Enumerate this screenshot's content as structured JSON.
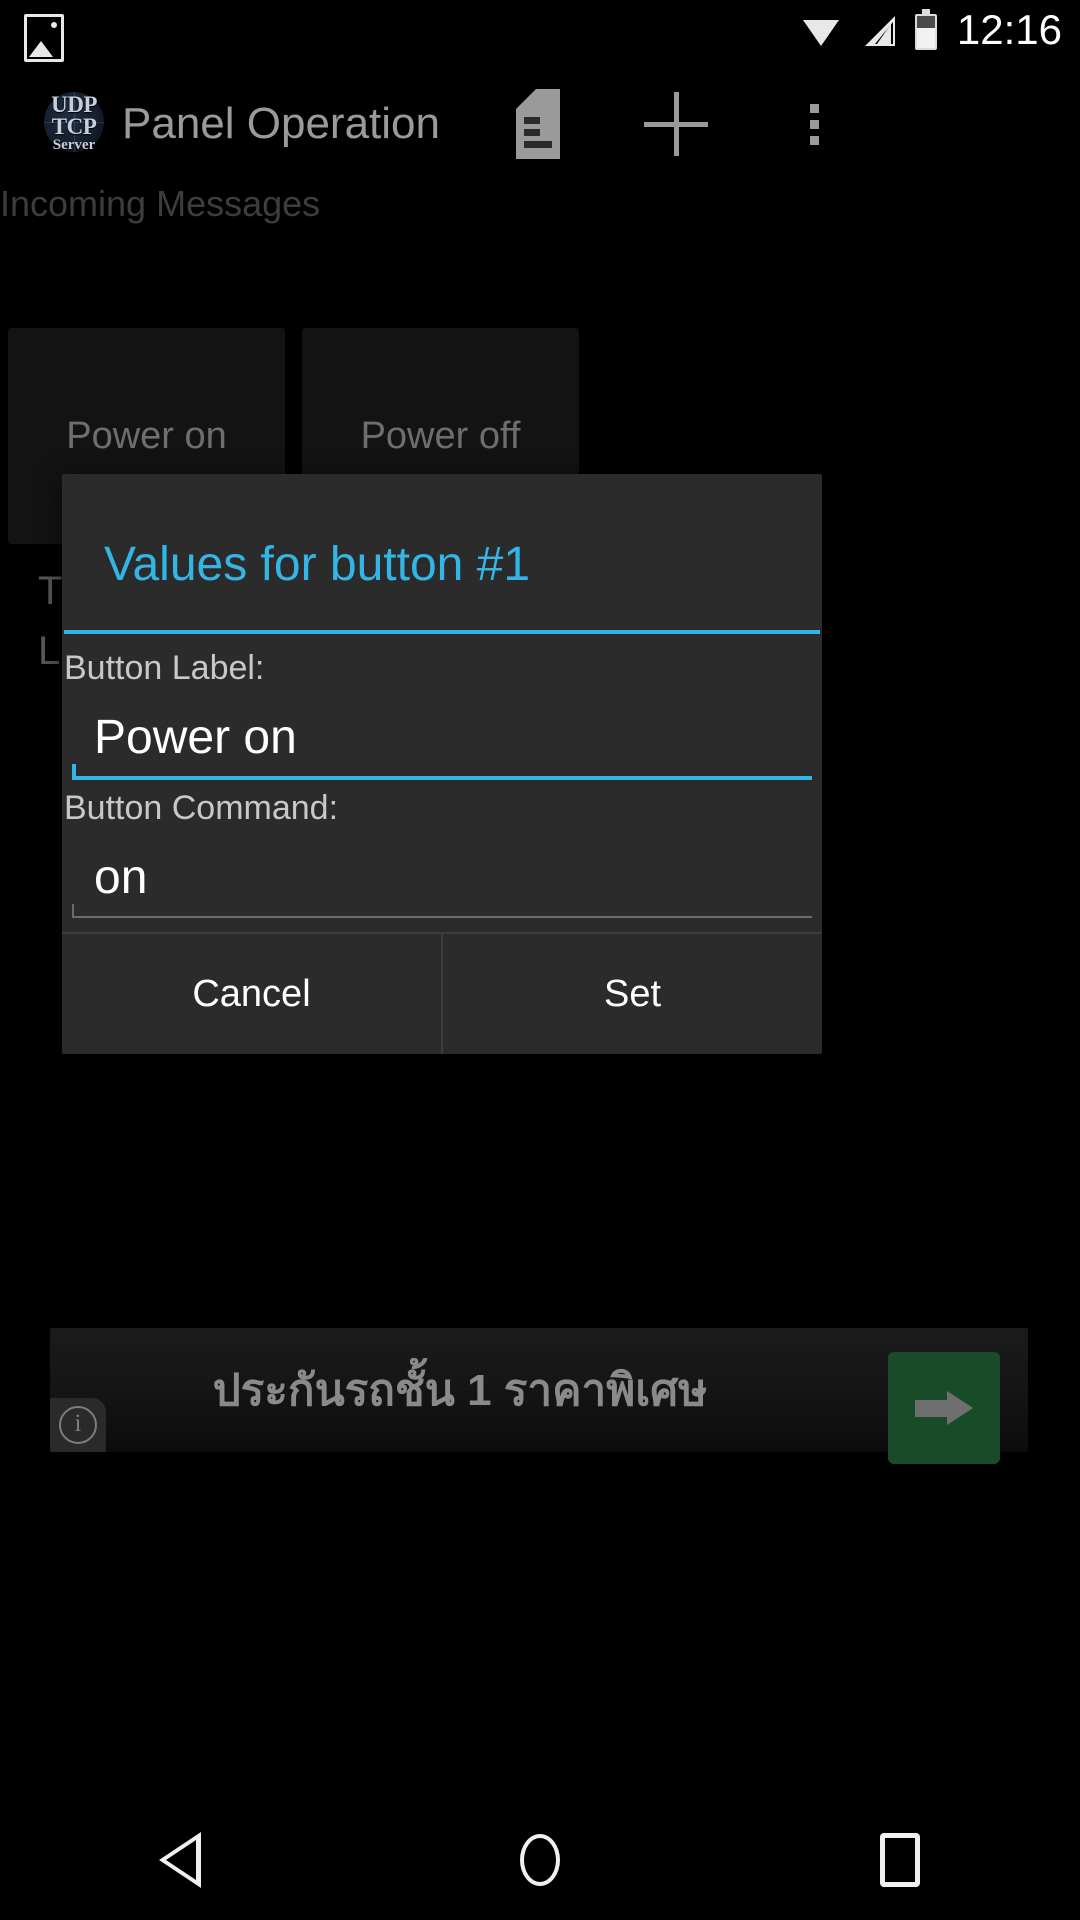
{
  "status_bar": {
    "notification_icon": "image-notification-icon",
    "wifi_icon": "wifi-icon",
    "signal_icon": "cellular-signal-icon",
    "battery_icon": "battery-icon",
    "time": "12:16"
  },
  "action_bar": {
    "app_icon": "udp-tcp-server-app-icon",
    "logo_line1": "UDP",
    "logo_line2": "TCP",
    "logo_line3": "Server",
    "title": "Panel Operation",
    "log_icon": "log-document-icon",
    "add_icon": "add-plus-icon",
    "overflow_icon": "overflow-menu-icon"
  },
  "content": {
    "subtitle": "Incoming Messages",
    "panel_buttons": [
      {
        "label": "Power on"
      },
      {
        "label": "Power off"
      }
    ],
    "background_text_line1": "T",
    "background_text_line2": "L"
  },
  "dialog": {
    "title": "Values for button #1",
    "accent_color": "#33b5e5",
    "fields": [
      {
        "label": "Button Label:",
        "value": "Power on",
        "focused": true
      },
      {
        "label": "Button Command:",
        "value": "on",
        "focused": false
      }
    ],
    "cancel_label": "Cancel",
    "set_label": "Set"
  },
  "ad_banner": {
    "text": "ประกันรถชั้น 1 ราคาพิเศษ",
    "info_icon": "ad-info-icon",
    "info_glyph": "i",
    "cta_icon": "arrow-right-icon",
    "cta_color": "#184c28"
  },
  "nav_bar": {
    "back_icon": "nav-back-icon",
    "home_icon": "nav-home-icon",
    "recents_icon": "nav-recents-icon"
  }
}
